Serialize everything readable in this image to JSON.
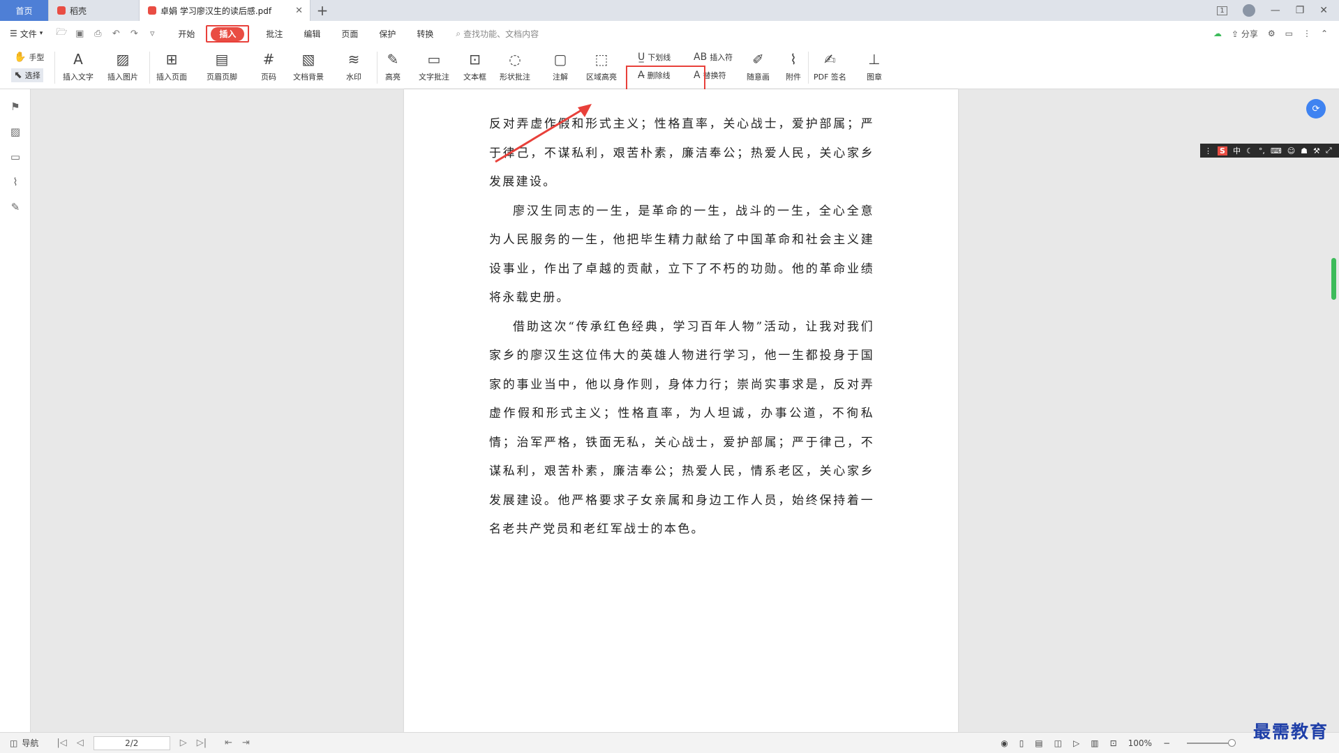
{
  "tabs": {
    "home": "首页",
    "docer": "稻壳",
    "active": "卓娟 学习廖汉生的读后感.pdf",
    "close": "✕",
    "new": "+"
  },
  "window": {
    "count_badge": "1"
  },
  "menubar": {
    "file": "文件",
    "tabs": [
      "开始",
      "插入",
      "批注",
      "编辑",
      "页面",
      "保护",
      "转换"
    ],
    "search_placeholder": "查找功能、文档内容",
    "share": "分享"
  },
  "ribbon": {
    "hand": "手型",
    "select": "选择",
    "insert_text": "插入文字",
    "insert_image": "插入图片",
    "insert_page": "插入页面",
    "header_footer": "页眉页脚",
    "page_number": "页码",
    "doc_background": "文档背景",
    "watermark": "水印",
    "highlight": "高亮",
    "text_comment": "文字批注",
    "text_box": "文本框",
    "shape_comment": "形状批注",
    "note": "注解",
    "area_highlight": "区域高亮",
    "underline": "下划线",
    "strikethrough": "删除线",
    "insert_mark": "插入符",
    "replace_mark": "替换符",
    "freehand": "随意画",
    "attachment": "附件",
    "pdf_sign": "PDF 签名",
    "stamp": "图章"
  },
  "document": {
    "paragraphs": [
      "反对弄虚作假和形式主义；性格直率，关心战士，爱护部属；严于律己，不谋私利，艰苦朴素，廉洁奉公；热爱人民，关心家乡发展建设。",
      "廖汉生同志的一生，是革命的一生，战斗的一生，全心全意为人民服务的一生，他把毕生精力献给了中国革命和社会主义建设事业，作出了卓越的贡献，立下了不朽的功勋。他的革命业绩将永载史册。",
      "借助这次“传承红色经典，学习百年人物”活动，让我对我们家乡的廖汉生这位伟大的英雄人物进行学习，他一生都投身于国家的事业当中，他以身作则，身体力行；崇尚实事求是，反对弄虚作假和形式主义；性格直率，为人坦诚，办事公道，不徇私情；治军严格，铁面无私，关心战士，爱护部属；严于律己，不谋私利，艰苦朴素，廉洁奉公；热爱人民，情系老区，关心家乡发展建设。他严格要求子女亲属和身边工作人员，始终保持着一名老共产党员和老红军战士的本色。"
    ]
  },
  "ime": {
    "s": "S",
    "mode": "中"
  },
  "statusbar": {
    "nav": "导航",
    "page": "2/2",
    "zoom": "100%"
  },
  "watermark_text": "最需教育",
  "colors": {
    "accent_red": "#e8403a",
    "home_tab_blue": "#4e7fd6",
    "float_blue": "#3f83f1"
  }
}
